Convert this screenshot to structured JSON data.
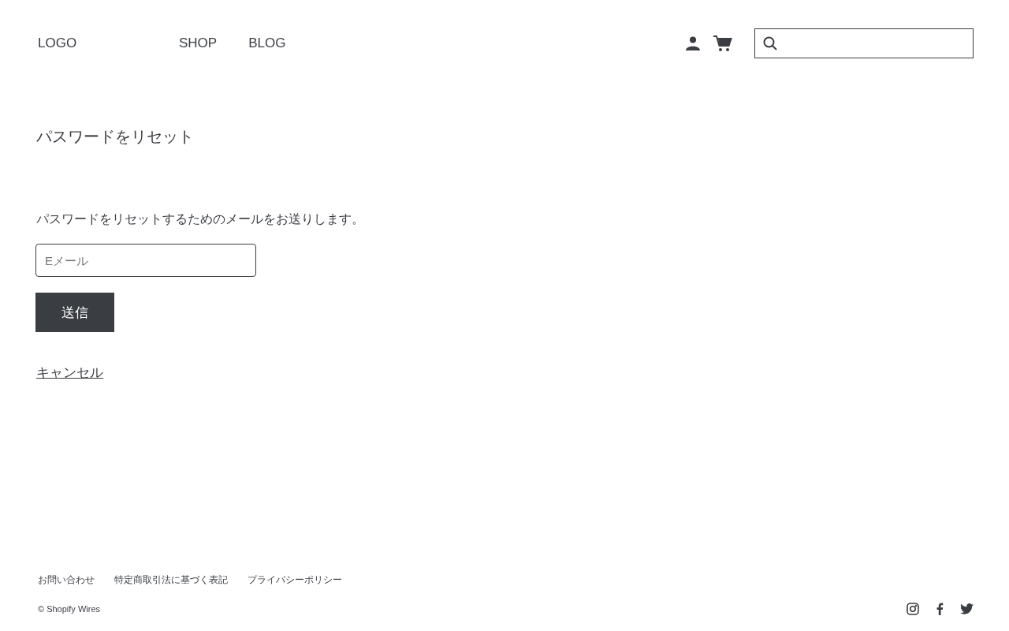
{
  "header": {
    "logo": "LOGO",
    "nav": [
      {
        "label": "SHOP"
      },
      {
        "label": "BLOG"
      }
    ]
  },
  "main": {
    "title": "パスワードをリセット",
    "description": "パスワードをリセットするためのメールをお送りします。",
    "email": {
      "placeholder": "Eメール"
    },
    "submit": "送信",
    "cancel": "キャンセル"
  },
  "footer": {
    "links": [
      {
        "label": "お問い合わせ"
      },
      {
        "label": "特定商取引法に基づく表記"
      },
      {
        "label": "プライバシーポリシー"
      }
    ],
    "copyright": "© Shopify Wires"
  }
}
